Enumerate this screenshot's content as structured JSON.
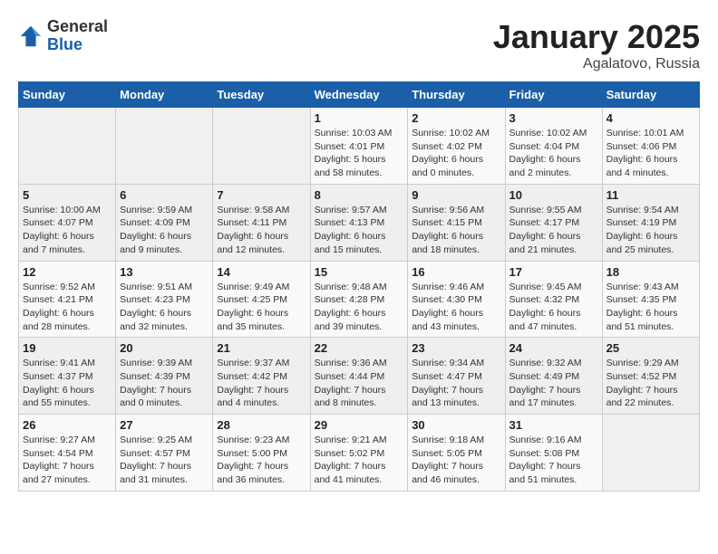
{
  "header": {
    "logo": {
      "general": "General",
      "blue": "Blue"
    },
    "title": "January 2025",
    "subtitle": "Agalatovo, Russia"
  },
  "weekdays": [
    "Sunday",
    "Monday",
    "Tuesday",
    "Wednesday",
    "Thursday",
    "Friday",
    "Saturday"
  ],
  "weeks": [
    [
      {
        "day": null
      },
      {
        "day": null
      },
      {
        "day": null
      },
      {
        "day": 1,
        "sunrise": "Sunrise: 10:03 AM",
        "sunset": "Sunset: 4:01 PM",
        "daylight": "Daylight: 5 hours and 58 minutes."
      },
      {
        "day": 2,
        "sunrise": "Sunrise: 10:02 AM",
        "sunset": "Sunset: 4:02 PM",
        "daylight": "Daylight: 6 hours and 0 minutes."
      },
      {
        "day": 3,
        "sunrise": "Sunrise: 10:02 AM",
        "sunset": "Sunset: 4:04 PM",
        "daylight": "Daylight: 6 hours and 2 minutes."
      },
      {
        "day": 4,
        "sunrise": "Sunrise: 10:01 AM",
        "sunset": "Sunset: 4:06 PM",
        "daylight": "Daylight: 6 hours and 4 minutes."
      }
    ],
    [
      {
        "day": 5,
        "sunrise": "Sunrise: 10:00 AM",
        "sunset": "Sunset: 4:07 PM",
        "daylight": "Daylight: 6 hours and 7 minutes."
      },
      {
        "day": 6,
        "sunrise": "Sunrise: 9:59 AM",
        "sunset": "Sunset: 4:09 PM",
        "daylight": "Daylight: 6 hours and 9 minutes."
      },
      {
        "day": 7,
        "sunrise": "Sunrise: 9:58 AM",
        "sunset": "Sunset: 4:11 PM",
        "daylight": "Daylight: 6 hours and 12 minutes."
      },
      {
        "day": 8,
        "sunrise": "Sunrise: 9:57 AM",
        "sunset": "Sunset: 4:13 PM",
        "daylight": "Daylight: 6 hours and 15 minutes."
      },
      {
        "day": 9,
        "sunrise": "Sunrise: 9:56 AM",
        "sunset": "Sunset: 4:15 PM",
        "daylight": "Daylight: 6 hours and 18 minutes."
      },
      {
        "day": 10,
        "sunrise": "Sunrise: 9:55 AM",
        "sunset": "Sunset: 4:17 PM",
        "daylight": "Daylight: 6 hours and 21 minutes."
      },
      {
        "day": 11,
        "sunrise": "Sunrise: 9:54 AM",
        "sunset": "Sunset: 4:19 PM",
        "daylight": "Daylight: 6 hours and 25 minutes."
      }
    ],
    [
      {
        "day": 12,
        "sunrise": "Sunrise: 9:52 AM",
        "sunset": "Sunset: 4:21 PM",
        "daylight": "Daylight: 6 hours and 28 minutes."
      },
      {
        "day": 13,
        "sunrise": "Sunrise: 9:51 AM",
        "sunset": "Sunset: 4:23 PM",
        "daylight": "Daylight: 6 hours and 32 minutes."
      },
      {
        "day": 14,
        "sunrise": "Sunrise: 9:49 AM",
        "sunset": "Sunset: 4:25 PM",
        "daylight": "Daylight: 6 hours and 35 minutes."
      },
      {
        "day": 15,
        "sunrise": "Sunrise: 9:48 AM",
        "sunset": "Sunset: 4:28 PM",
        "daylight": "Daylight: 6 hours and 39 minutes."
      },
      {
        "day": 16,
        "sunrise": "Sunrise: 9:46 AM",
        "sunset": "Sunset: 4:30 PM",
        "daylight": "Daylight: 6 hours and 43 minutes."
      },
      {
        "day": 17,
        "sunrise": "Sunrise: 9:45 AM",
        "sunset": "Sunset: 4:32 PM",
        "daylight": "Daylight: 6 hours and 47 minutes."
      },
      {
        "day": 18,
        "sunrise": "Sunrise: 9:43 AM",
        "sunset": "Sunset: 4:35 PM",
        "daylight": "Daylight: 6 hours and 51 minutes."
      }
    ],
    [
      {
        "day": 19,
        "sunrise": "Sunrise: 9:41 AM",
        "sunset": "Sunset: 4:37 PM",
        "daylight": "Daylight: 6 hours and 55 minutes."
      },
      {
        "day": 20,
        "sunrise": "Sunrise: 9:39 AM",
        "sunset": "Sunset: 4:39 PM",
        "daylight": "Daylight: 7 hours and 0 minutes."
      },
      {
        "day": 21,
        "sunrise": "Sunrise: 9:37 AM",
        "sunset": "Sunset: 4:42 PM",
        "daylight": "Daylight: 7 hours and 4 minutes."
      },
      {
        "day": 22,
        "sunrise": "Sunrise: 9:36 AM",
        "sunset": "Sunset: 4:44 PM",
        "daylight": "Daylight: 7 hours and 8 minutes."
      },
      {
        "day": 23,
        "sunrise": "Sunrise: 9:34 AM",
        "sunset": "Sunset: 4:47 PM",
        "daylight": "Daylight: 7 hours and 13 minutes."
      },
      {
        "day": 24,
        "sunrise": "Sunrise: 9:32 AM",
        "sunset": "Sunset: 4:49 PM",
        "daylight": "Daylight: 7 hours and 17 minutes."
      },
      {
        "day": 25,
        "sunrise": "Sunrise: 9:29 AM",
        "sunset": "Sunset: 4:52 PM",
        "daylight": "Daylight: 7 hours and 22 minutes."
      }
    ],
    [
      {
        "day": 26,
        "sunrise": "Sunrise: 9:27 AM",
        "sunset": "Sunset: 4:54 PM",
        "daylight": "Daylight: 7 hours and 27 minutes."
      },
      {
        "day": 27,
        "sunrise": "Sunrise: 9:25 AM",
        "sunset": "Sunset: 4:57 PM",
        "daylight": "Daylight: 7 hours and 31 minutes."
      },
      {
        "day": 28,
        "sunrise": "Sunrise: 9:23 AM",
        "sunset": "Sunset: 5:00 PM",
        "daylight": "Daylight: 7 hours and 36 minutes."
      },
      {
        "day": 29,
        "sunrise": "Sunrise: 9:21 AM",
        "sunset": "Sunset: 5:02 PM",
        "daylight": "Daylight: 7 hours and 41 minutes."
      },
      {
        "day": 30,
        "sunrise": "Sunrise: 9:18 AM",
        "sunset": "Sunset: 5:05 PM",
        "daylight": "Daylight: 7 hours and 46 minutes."
      },
      {
        "day": 31,
        "sunrise": "Sunrise: 9:16 AM",
        "sunset": "Sunset: 5:08 PM",
        "daylight": "Daylight: 7 hours and 51 minutes."
      },
      {
        "day": null
      }
    ]
  ]
}
